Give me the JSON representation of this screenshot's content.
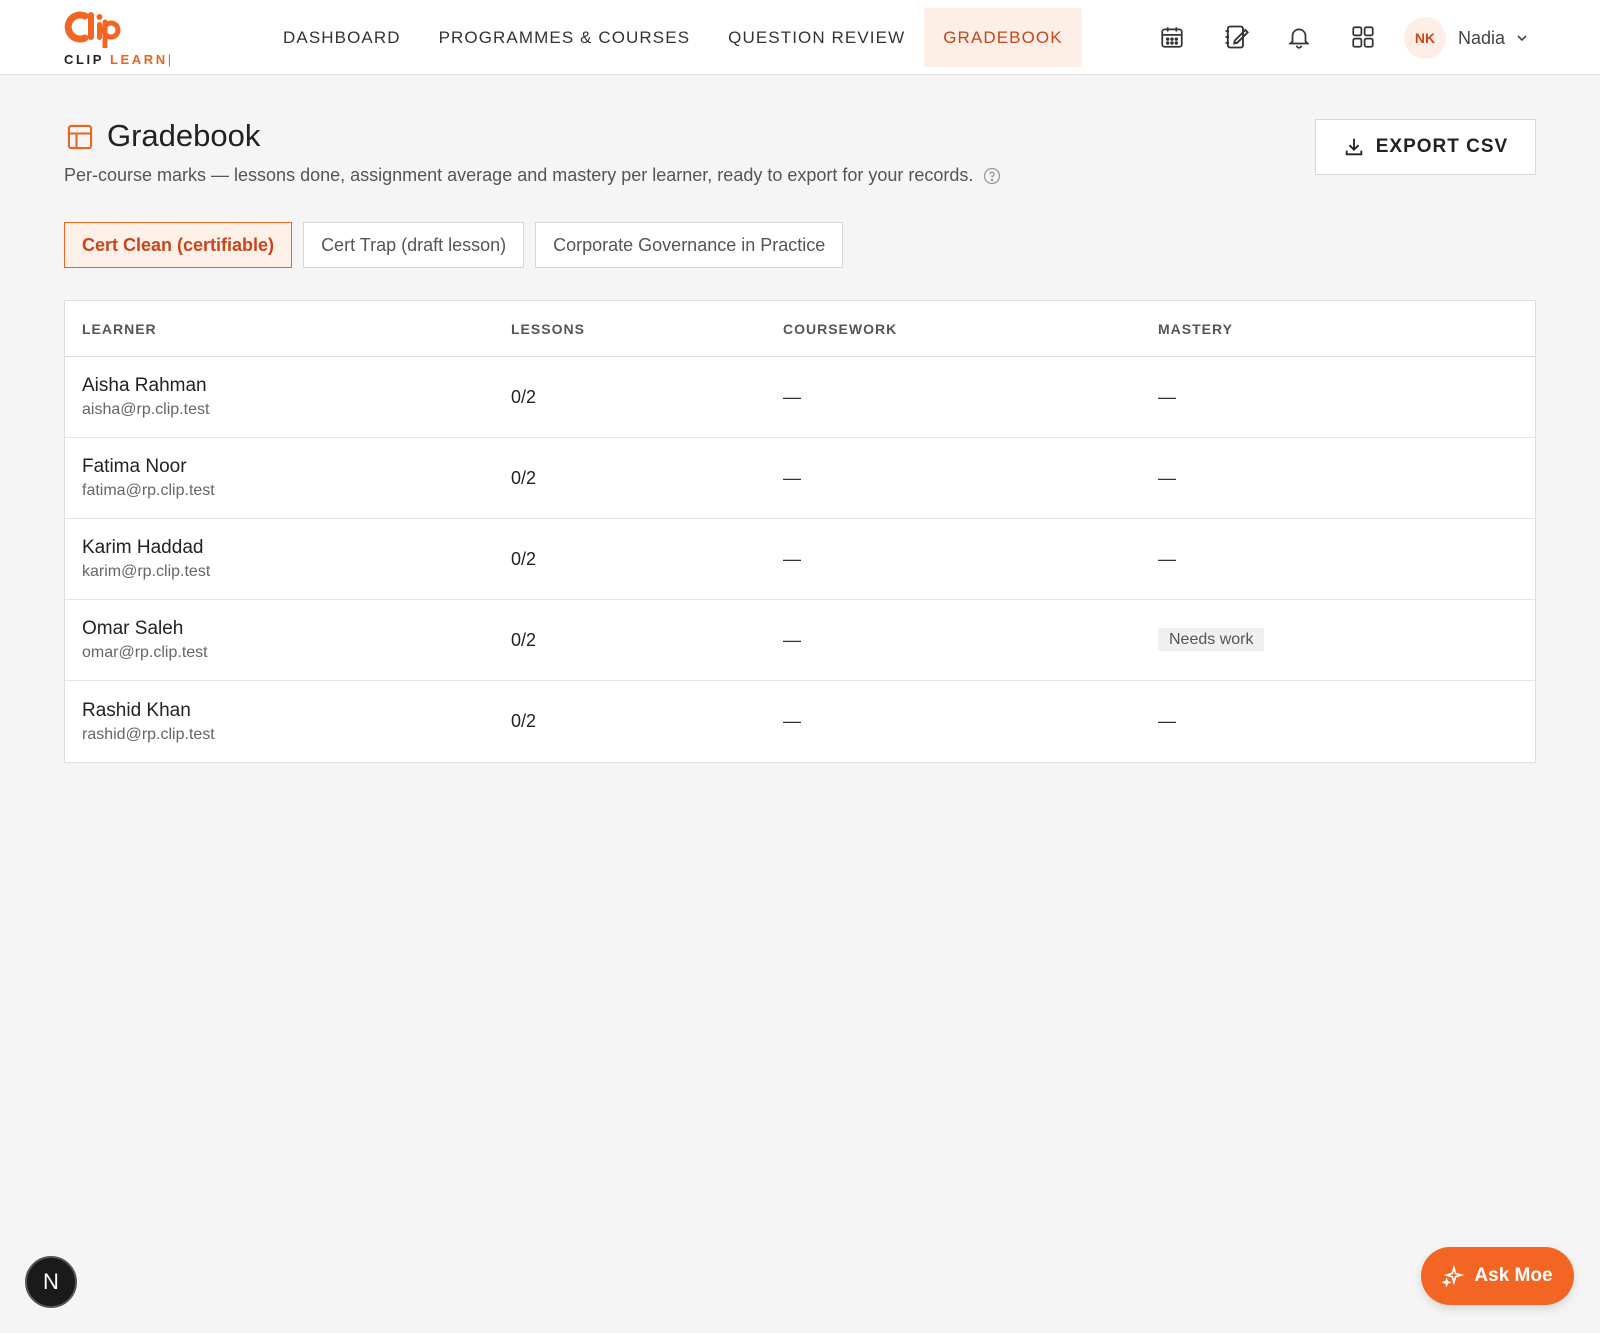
{
  "brand": {
    "logo_word": "Clip",
    "name_part1": "CLIP",
    "name_part2": "LEARN",
    "accent_color": "#e8651f"
  },
  "nav": {
    "items": [
      {
        "label": "DASHBOARD",
        "active": false
      },
      {
        "label": "PROGRAMMES & COURSES",
        "active": false
      },
      {
        "label": "QUESTION REVIEW",
        "active": false
      },
      {
        "label": "GRADEBOOK",
        "active": true
      }
    ]
  },
  "header_icons": [
    "calendar-icon",
    "notebook-edit-icon",
    "bell-icon",
    "apps-grid-icon"
  ],
  "user": {
    "initials": "NK",
    "name": "Nadia"
  },
  "page": {
    "title": "Gradebook",
    "description": "Per-course marks — lessons done, assignment average and mastery per learner, ready to export for your records.",
    "export_label": "EXPORT CSV"
  },
  "course_tabs": [
    {
      "label": "Cert Clean (certifiable)",
      "active": true
    },
    {
      "label": "Cert Trap (draft lesson)",
      "active": false
    },
    {
      "label": "Corporate Governance in Practice",
      "active": false
    }
  ],
  "table": {
    "columns": [
      "LEARNER",
      "LESSONS",
      "COURSEWORK",
      "MASTERY"
    ],
    "rows": [
      {
        "name": "Aisha Rahman",
        "email": "aisha@rp.clip.test",
        "lessons": "0/2",
        "coursework": "—",
        "mastery": "—",
        "mastery_badge": false
      },
      {
        "name": "Fatima Noor",
        "email": "fatima@rp.clip.test",
        "lessons": "0/2",
        "coursework": "—",
        "mastery": "—",
        "mastery_badge": false
      },
      {
        "name": "Karim Haddad",
        "email": "karim@rp.clip.test",
        "lessons": "0/2",
        "coursework": "—",
        "mastery": "—",
        "mastery_badge": false
      },
      {
        "name": "Omar Saleh",
        "email": "omar@rp.clip.test",
        "lessons": "0/2",
        "coursework": "—",
        "mastery": "Needs work",
        "mastery_badge": true
      },
      {
        "name": "Rashid Khan",
        "email": "rashid@rp.clip.test",
        "lessons": "0/2",
        "coursework": "—",
        "mastery": "—",
        "mastery_badge": false
      }
    ]
  },
  "floating": {
    "dev_badge": "N",
    "assistant_label": "Ask Moe"
  }
}
